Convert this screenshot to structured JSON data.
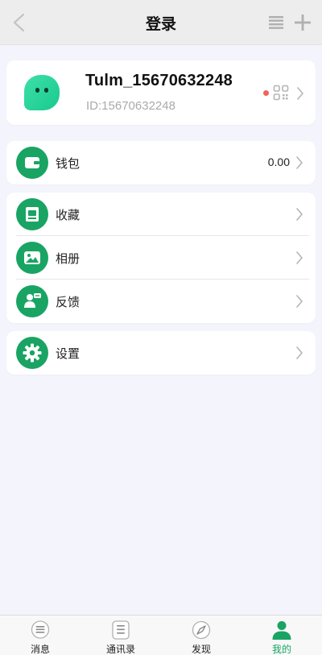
{
  "header": {
    "title": "登录",
    "back_icon": "chevron-left-icon",
    "list_icon": "list-icon",
    "add_icon": "plus-icon"
  },
  "profile": {
    "username": "Tulm_15670632248",
    "user_id": "ID:15670632248",
    "avatar_icon": "chat-bubble-avatar",
    "qr_icon": "qr-code-icon",
    "status_color": "#f0645a"
  },
  "menu": {
    "wallet": {
      "label": "钱包",
      "value": "0.00",
      "icon": "wallet-icon"
    },
    "favorites": {
      "label": "收藏",
      "icon": "book-icon"
    },
    "album": {
      "label": "相册",
      "icon": "image-icon"
    },
    "feedback": {
      "label": "反馈",
      "icon": "feedback-icon"
    },
    "settings": {
      "label": "设置",
      "icon": "gear-icon"
    }
  },
  "tabbar": {
    "tabs": [
      {
        "label": "消息",
        "icon": "message-icon",
        "active": false
      },
      {
        "label": "通讯录",
        "icon": "contacts-icon",
        "active": false
      },
      {
        "label": "发现",
        "icon": "compass-icon",
        "active": false
      },
      {
        "label": "我的",
        "icon": "person-icon",
        "active": true
      }
    ]
  },
  "colors": {
    "accent": "#19a463",
    "background": "#f4f4fc",
    "header_bg": "#ededed"
  }
}
